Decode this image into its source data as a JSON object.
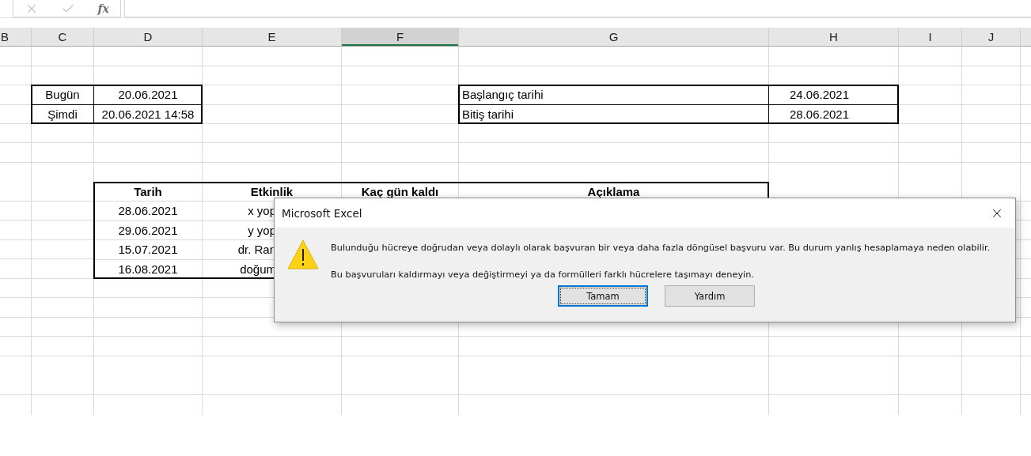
{
  "formula_bar": {
    "function_label": "fx"
  },
  "column_headers": [
    {
      "label": "B",
      "selected": false
    },
    {
      "label": "C",
      "selected": false
    },
    {
      "label": "D",
      "selected": false
    },
    {
      "label": "E",
      "selected": false
    },
    {
      "label": "F",
      "selected": true
    },
    {
      "label": "G",
      "selected": false
    },
    {
      "label": "H",
      "selected": false
    },
    {
      "label": "I",
      "selected": false
    },
    {
      "label": "J",
      "selected": false
    }
  ],
  "today_block": [
    {
      "label": "Bugün",
      "value": "20.06.2021"
    },
    {
      "label": "Şimdi",
      "value": "20.06.2021 14:58"
    }
  ],
  "date_range": [
    {
      "label": "Başlangıç tarihi",
      "value": "24.06.2021"
    },
    {
      "label": "Bitiş tarihi",
      "value": "28.06.2021"
    }
  ],
  "events_table": {
    "columns": [
      "Tarih",
      "Etkinlik",
      "Kaç gün kaldı",
      "Açıklama"
    ],
    "rows": [
      {
        "date": "28.06.2021",
        "event": "x yop"
      },
      {
        "date": "29.06.2021",
        "event": "y yop"
      },
      {
        "date": "15.07.2021",
        "event": "dr. Ran"
      },
      {
        "date": "16.08.2021",
        "event": "doğum"
      }
    ]
  },
  "dialog": {
    "title": "Microsoft Excel",
    "messages": [
      "Bulunduğu hücreye doğrudan veya dolaylı olarak başvuran bir veya daha fazla döngüsel başvuru var. Bu durum yanlış hesaplamaya neden olabilir.",
      "Bu başvuruları kaldırmayı veya değiştirmeyi ya da formülleri farklı hücrelere taşımayı deneyin."
    ],
    "buttons": [
      {
        "label": "Tamam",
        "focused": true
      },
      {
        "label": "Yardım",
        "focused": false
      }
    ]
  }
}
